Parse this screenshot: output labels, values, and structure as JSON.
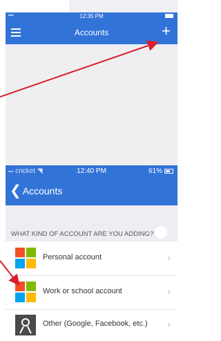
{
  "top": {
    "time": "12:35 PM",
    "title": "Accounts",
    "plus": "+"
  },
  "bottom": {
    "carrier": "cricket",
    "time": "12:40 PM",
    "battery": "61%",
    "back_label": "Accounts",
    "section_header": "WHAT KIND OF ACCOUNT ARE YOU ADDING?",
    "options": [
      {
        "label": "Personal account"
      },
      {
        "label": "Work or school account"
      },
      {
        "label": "Other (Google, Facebook, etc.)"
      }
    ]
  },
  "colors": {
    "nav_blue": "#3273d8",
    "arrow_red": "#d8202a"
  },
  "icons": [
    "menu-icon",
    "plus-icon",
    "wifi-icon",
    "battery-icon",
    "back-chevron-icon",
    "chevron-right-icon",
    "microsoft-logo-icon",
    "person-icon"
  ]
}
